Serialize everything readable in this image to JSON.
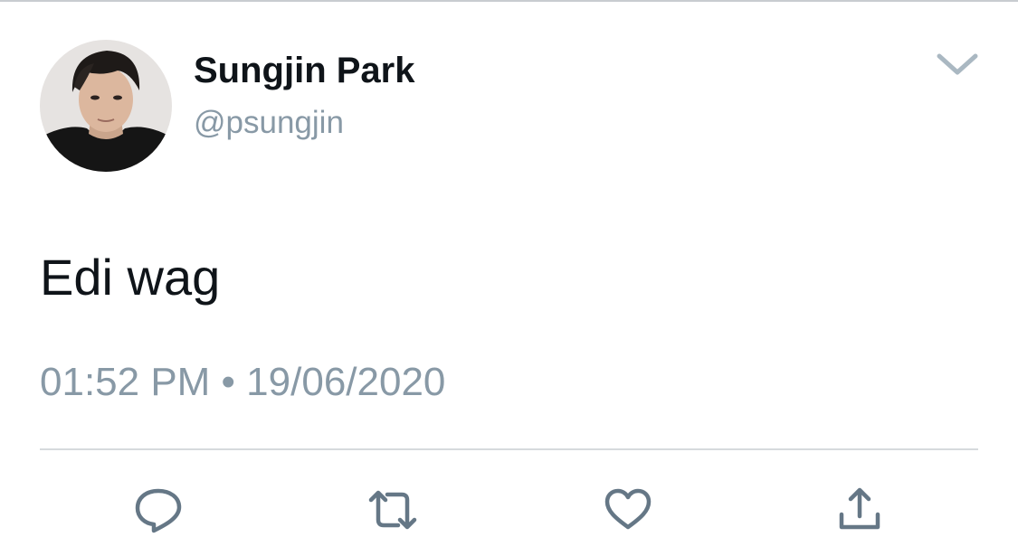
{
  "tweet": {
    "author": {
      "display_name": "Sungjin Park",
      "handle": "@psungjin"
    },
    "text": "Edi wag",
    "timestamp": "01:52 PM • 19/06/2020"
  },
  "actions": [
    {
      "name": "reply",
      "icon": "reply-icon"
    },
    {
      "name": "retweet",
      "icon": "retweet-icon"
    },
    {
      "name": "like",
      "icon": "heart-icon"
    },
    {
      "name": "share",
      "icon": "share-icon"
    }
  ],
  "colors": {
    "name_text": "#0f1419",
    "secondary_text": "#8899a6",
    "icon": "#657786",
    "divider": "#d6dadd"
  }
}
